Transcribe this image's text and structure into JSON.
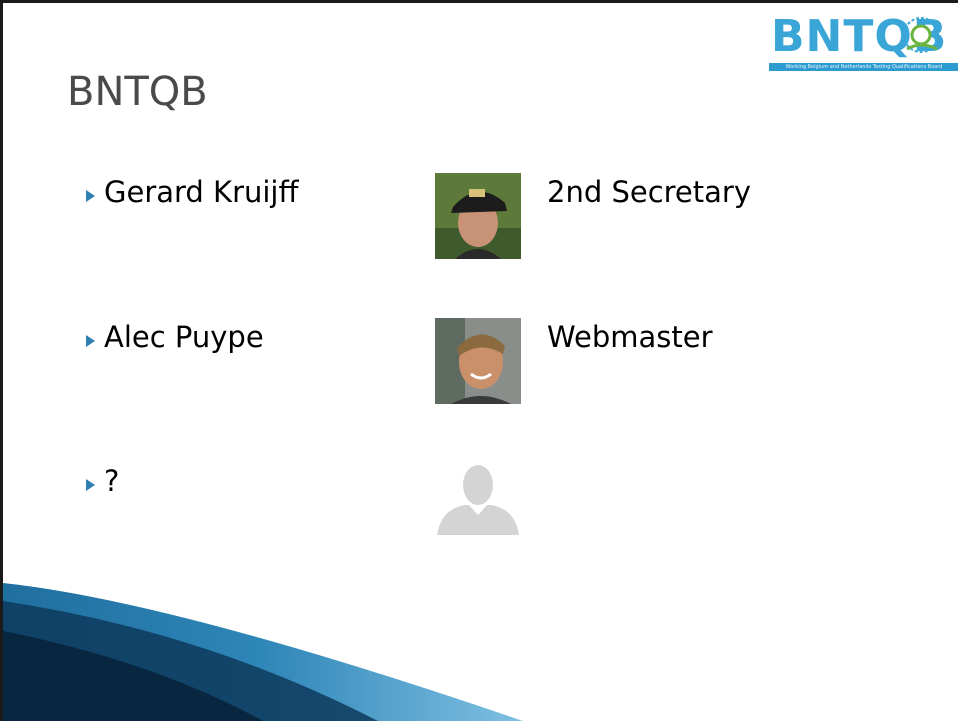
{
  "slide": {
    "title": "BNTQB",
    "logo": {
      "text": "BNTQB",
      "tagline": "Working Belgium and Netherlands Testing Qualifications Board"
    },
    "members": [
      {
        "name": "Gerard Kruijff",
        "role": "2nd Secretary",
        "photo_icon": "person-photo-icon"
      },
      {
        "name": "Alec Puype",
        "role": "Webmaster",
        "photo_icon": "person-photo-icon"
      },
      {
        "name": "?",
        "role": "",
        "photo_icon": "placeholder-avatar-icon"
      }
    ],
    "colors": {
      "accent": "#2f7fb2",
      "logo_blue": "#3aa6d8",
      "title": "#4a4a4a",
      "swoosh_dark": "#0d3a5c"
    }
  }
}
